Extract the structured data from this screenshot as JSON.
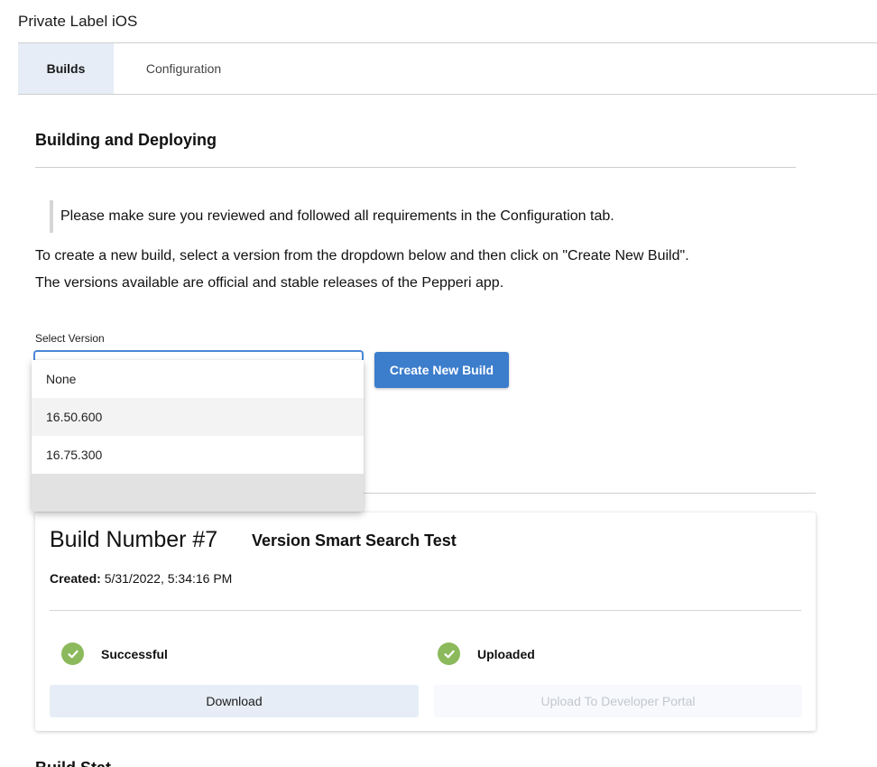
{
  "app": {
    "title": "Private Label iOS"
  },
  "tabs": [
    {
      "label": "Builds",
      "active": true
    },
    {
      "label": "Configuration",
      "active": false
    }
  ],
  "building": {
    "title": "Building and Deploying",
    "note": "Please make sure you reviewed and followed all requirements in the Configuration tab.",
    "paragraph1": "To create a new build, select a version from the dropdown below and then click on \"Create New Build\".",
    "paragraph2": "The versions available are official and stable releases of the Pepperi app."
  },
  "version_select": {
    "label": "Select Version",
    "options": [
      "None",
      "16.50.600",
      "16.75.300",
      ""
    ],
    "highlighted_option": "16.50.600"
  },
  "create_button": {
    "label": "Create New Build"
  },
  "build_card": {
    "number": "Build Number #7",
    "version": "Version Smart Search Test",
    "created_label": "Created:",
    "created_value": "5/31/2022, 5:34:16 PM",
    "status_build": "Successful",
    "status_upload": "Uploaded",
    "download_label": "Download",
    "upload_label": "Upload To Developer Portal"
  },
  "next_section": {
    "title": "Build Stat"
  },
  "colors": {
    "accent": "#3c7dcc",
    "success": "#8bb95b",
    "tab_active_bg": "#e6edf7"
  }
}
